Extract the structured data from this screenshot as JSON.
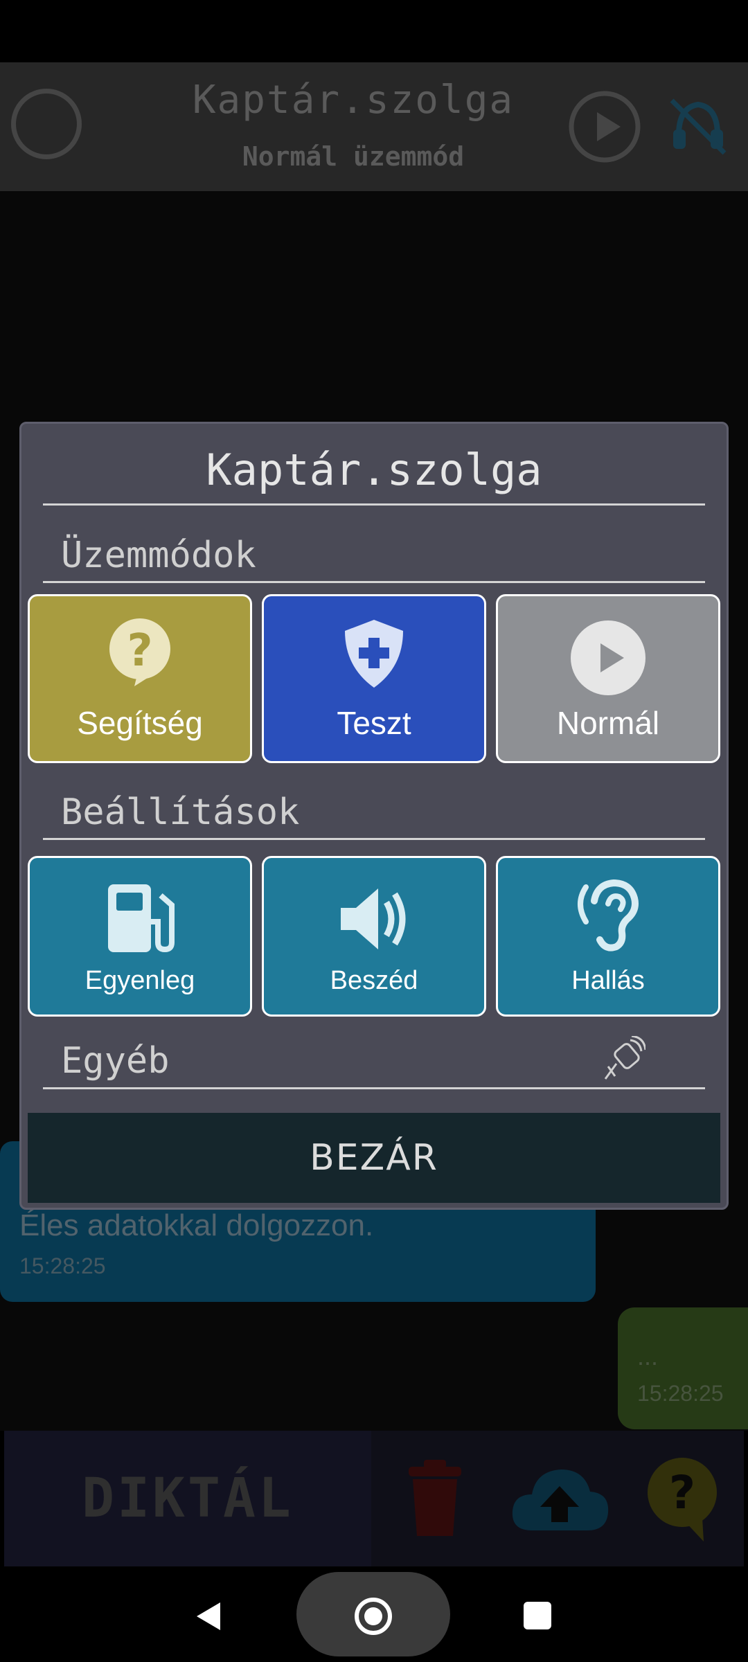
{
  "app": {
    "title": "Kaptár.szolga",
    "subtitle": "Normál üzemmód"
  },
  "messages": [
    {
      "text": "Éles adatokkal dolgozzon.",
      "time": "15:28:25",
      "color": "#0c5a7e"
    },
    {
      "text": "...",
      "time": "15:28:25",
      "color": "#3b5a23"
    }
  ],
  "bottom_bar": {
    "dictate_label": "DIKTÁL",
    "icons": [
      "trash-icon",
      "cloud-upload-icon",
      "help-bubble-icon"
    ]
  },
  "dialog": {
    "title": "Kaptár.szolga",
    "sections": {
      "modes": "Üzemmódok",
      "settings": "Beállítások",
      "other": "Egyéb"
    },
    "modes": [
      {
        "label": "Segítség",
        "icon": "question-bubble-icon",
        "color": "#a89c40"
      },
      {
        "label": "Teszt",
        "icon": "shield-plus-icon",
        "color": "#2a4fbb"
      },
      {
        "label": "Normál",
        "icon": "play-circle-icon",
        "color": "#8e9094"
      }
    ],
    "settings": [
      {
        "label": "Egyenleg",
        "icon": "fuel-pump-icon",
        "color": "#1f7a99"
      },
      {
        "label": "Beszéd",
        "icon": "speaker-icon",
        "color": "#1f7a99"
      },
      {
        "label": "Hallás",
        "icon": "ear-icon",
        "color": "#1f7a99"
      }
    ],
    "other_icon": "satellite-icon",
    "close_label": "BEZÁR"
  }
}
